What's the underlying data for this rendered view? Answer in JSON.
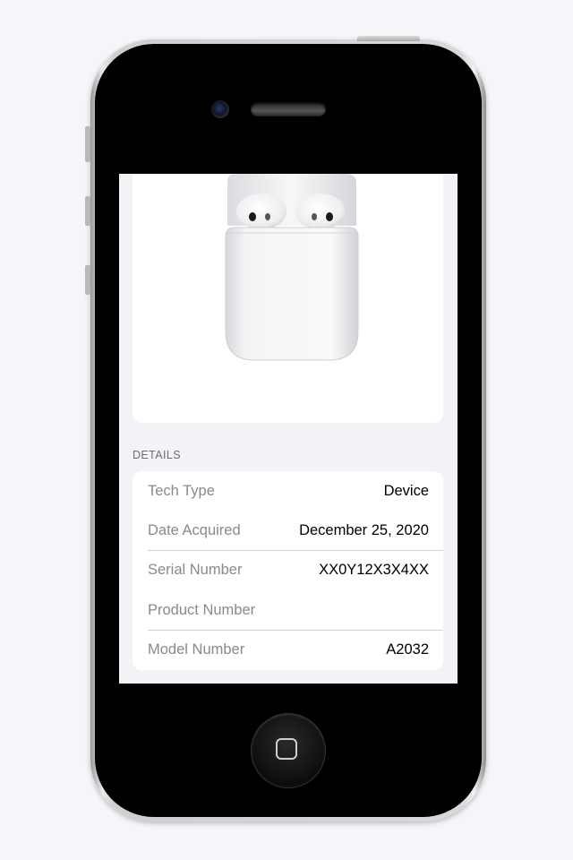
{
  "device": {
    "icons": {
      "camera": "front-camera-icon",
      "speaker": "earpiece-speaker-icon",
      "home": "home-square-icon"
    }
  },
  "product": {
    "image_icon": "airpods-case-icon"
  },
  "details": {
    "header": "DETAILS",
    "rows": [
      {
        "label": "Tech Type",
        "value": "Device"
      },
      {
        "label": "Date Acquired",
        "value": "December 25, 2020"
      },
      {
        "label": "Serial Number",
        "value": "XX0Y12X3X4XX"
      },
      {
        "label": "Product Number",
        "value": ""
      },
      {
        "label": "Model Number",
        "value": "A2032"
      }
    ]
  },
  "colors": {
    "screen_background": "#f2f2f7",
    "card_background": "#ffffff",
    "label_gray": "#8a8a8e",
    "separator": "#d1d1d6",
    "phone_bezel": "#000000"
  }
}
